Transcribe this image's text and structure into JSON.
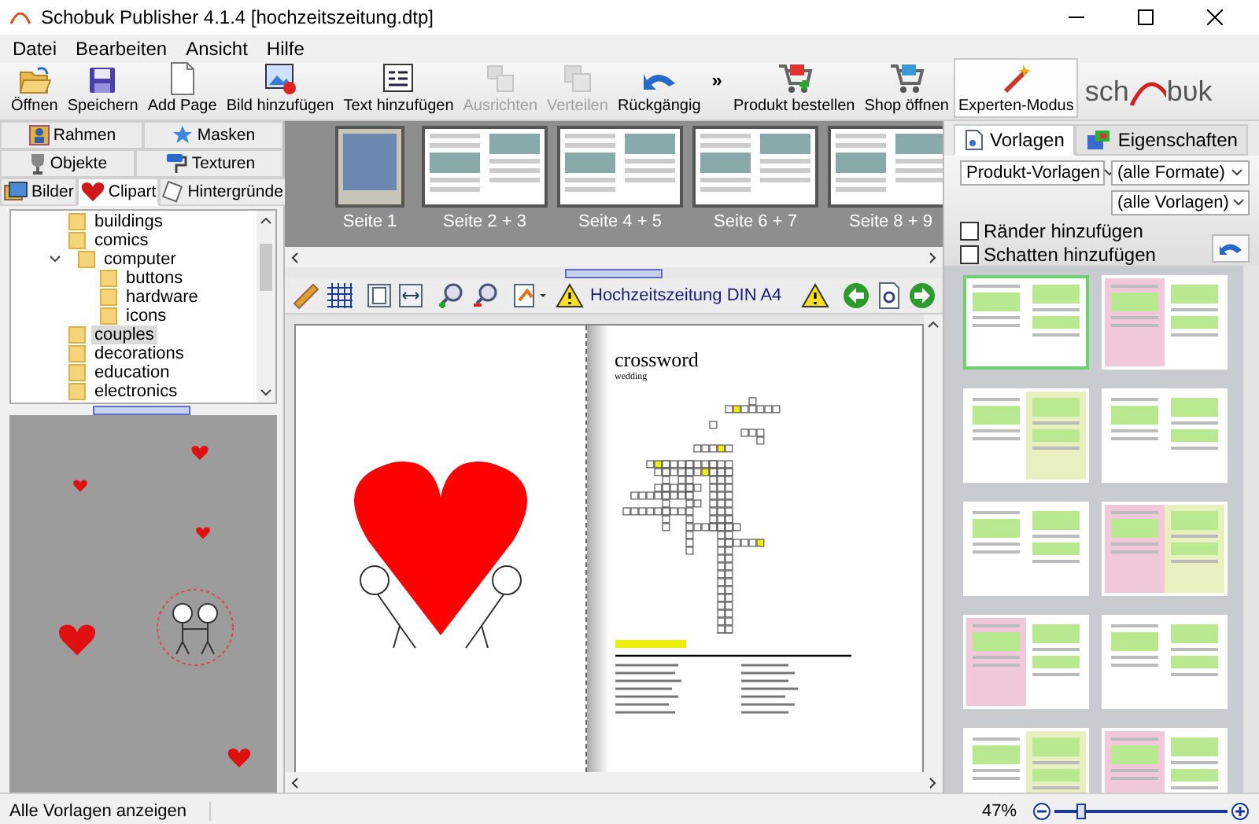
{
  "window": {
    "title": "Schobuk Publisher 4.1.4 [hochzeitszeitung.dtp]"
  },
  "menu": [
    "Datei",
    "Bearbeiten",
    "Ansicht",
    "Hilfe"
  ],
  "toolbar": {
    "items": [
      {
        "label": "Öffnen",
        "disabled": false,
        "pressed": false
      },
      {
        "label": "Speichern",
        "disabled": false,
        "pressed": false
      },
      {
        "label": "Add Page",
        "disabled": false,
        "pressed": false
      },
      {
        "label": "Bild hinzufügen",
        "disabled": false,
        "pressed": false
      },
      {
        "label": "Text hinzufügen",
        "disabled": false,
        "pressed": false
      },
      {
        "label": "Ausrichten",
        "disabled": true,
        "pressed": false
      },
      {
        "label": "Verteilen",
        "disabled": true,
        "pressed": false
      },
      {
        "label": "Rückgängig",
        "disabled": false,
        "pressed": false
      }
    ],
    "overflow": "»",
    "right_items": [
      {
        "label": "Produkt bestellen",
        "disabled": false,
        "pressed": false
      },
      {
        "label": "Shop öffnen",
        "disabled": false,
        "pressed": false
      },
      {
        "label": "Experten-Modus",
        "disabled": false,
        "pressed": true
      }
    ],
    "logo": {
      "left": "sch",
      "right": "bυk"
    }
  },
  "left_panel": {
    "tab_rows": [
      {
        "tabs": [
          {
            "label": "Rahmen",
            "selected": false
          },
          {
            "label": "Masken",
            "selected": false
          }
        ]
      },
      {
        "tabs": [
          {
            "label": "Objekte",
            "selected": false
          },
          {
            "label": "Texturen",
            "selected": false
          }
        ]
      },
      {
        "tabs": [
          {
            "label": "Bilder",
            "selected": false
          },
          {
            "label": "Clipart",
            "selected": true
          },
          {
            "label": "Hintergründe",
            "selected": false
          }
        ]
      }
    ],
    "tree": [
      {
        "label": "buildings",
        "selected": false
      },
      {
        "label": "comics",
        "selected": false
      },
      {
        "label": "computer",
        "selected": false,
        "expanded": true,
        "children": [
          {
            "label": "buttons",
            "selected": false
          },
          {
            "label": "hardware",
            "selected": false
          },
          {
            "label": "icons",
            "selected": false
          }
        ]
      },
      {
        "label": "couples",
        "selected": true
      },
      {
        "label": "decorations",
        "selected": false
      },
      {
        "label": "education",
        "selected": false
      },
      {
        "label": "electronics",
        "selected": false
      }
    ]
  },
  "pages": [
    {
      "label": "Seite 1",
      "kind": "single"
    },
    {
      "label": "Seite 2 + 3",
      "kind": "spread"
    },
    {
      "label": "Seite 4 + 5",
      "kind": "spread"
    },
    {
      "label": "Seite 6 + 7",
      "kind": "spread"
    },
    {
      "label": "Seite 8 + 9",
      "kind": "spread"
    }
  ],
  "editor": {
    "document_name": "Hochzeitszeitung DIN A4",
    "page_title": "crossword",
    "page_subtitle": "wedding"
  },
  "right_panel": {
    "tabs": [
      {
        "label": "Vorlagen",
        "selected": true
      },
      {
        "label": "Eigenschaften",
        "selected": false
      }
    ],
    "selects": [
      {
        "value": "Produkt-Vorlagen"
      },
      {
        "value": "(alle Formate)"
      },
      {
        "value": "(alle Vorlagen)"
      }
    ],
    "checkboxes": [
      {
        "label": "Ränder hinzufügen",
        "checked": false
      },
      {
        "label": "Schatten hinzufügen",
        "checked": false
      }
    ],
    "templates": [
      {
        "selected": true
      },
      {
        "selected": false
      },
      {
        "selected": false
      },
      {
        "selected": false
      },
      {
        "selected": false
      },
      {
        "selected": false
      },
      {
        "selected": false
      },
      {
        "selected": false
      },
      {
        "selected": false
      },
      {
        "selected": false
      }
    ]
  },
  "status_bar": {
    "text": "Alle Vorlagen anzeigen",
    "zoom": "47%",
    "zoom_slider": {
      "level": 0.15
    }
  }
}
